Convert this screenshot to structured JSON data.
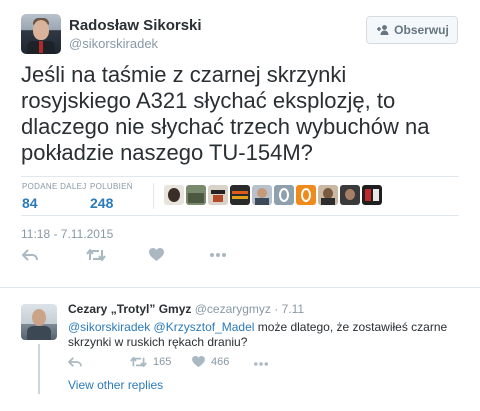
{
  "tweet": {
    "author_name": "Radosław Sikorski",
    "author_handle": "@sikorskiradek",
    "follow_label": "Obserwuj",
    "text": "Jeśli na taśmie z czarnej skrzynki rosyjskiego A321 słychać eksplozję, to dlaczego nie słychać trzech wybuchów na pokładzie naszego TU-154M?",
    "stats": {
      "retweets_label": "PODANE DALEJ",
      "retweets": "84",
      "likes_label": "POLUBIEŃ",
      "likes": "248"
    },
    "timestamp": "11:18 - 7.11.2015",
    "actions": [
      "reply-icon",
      "retweet-icon",
      "like-icon",
      "more-icon"
    ]
  },
  "reply": {
    "author_name": "Cezary „Trotyl” Gmyz",
    "author_handle": "@cezarygmyz",
    "date": "· 7.11",
    "mention1": "@sikorskiradek",
    "mention2": "@Krzysztof_Madel",
    "text": " może dlatego, że zostawiłeś czarne skrzynki w ruskich rękach draniu?",
    "retweets": "165",
    "likes": "466",
    "view_replies": "View other replies"
  },
  "colors": {
    "link": "#2b7bb9",
    "muted": "#8899a6",
    "text": "#292f33",
    "border": "#e1e8ed"
  }
}
